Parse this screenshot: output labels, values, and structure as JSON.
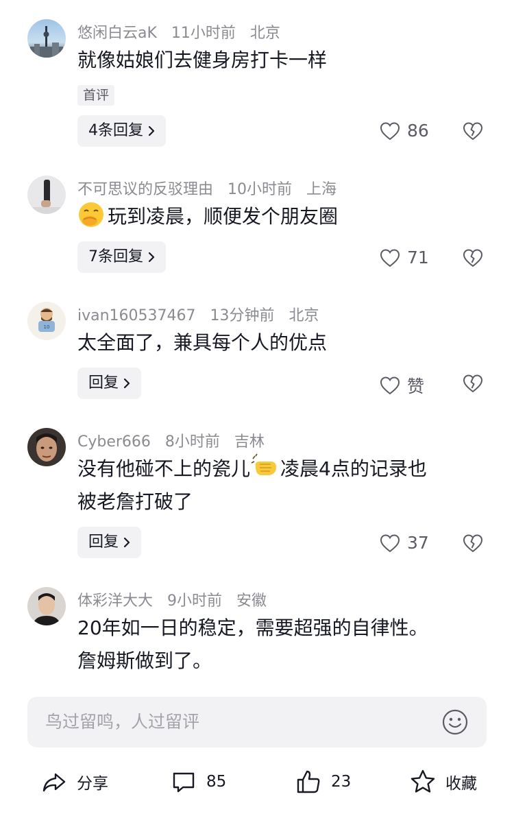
{
  "comments": [
    {
      "username": "悠闲白云aK",
      "time": "11小时前",
      "location": "北京",
      "text": "就像姑娘们去健身房打卡一样",
      "tag": "首评",
      "replies": "4条回复",
      "likes": "86"
    },
    {
      "username": "不可思议的反驳理由",
      "time": "10小时前",
      "location": "上海",
      "emoji": "covering-mouth-emoji",
      "text": "玩到凌晨，顺便发个朋友圈",
      "replies": "7条回复",
      "likes": "71"
    },
    {
      "username": "ivan160537467",
      "time": "13分钟前",
      "location": "北京",
      "text": "太全面了，兼具每个人的优点",
      "replies": "回复",
      "likes": "赞"
    },
    {
      "username": "Cyber666",
      "time": "8小时前",
      "location": "吉林",
      "text_part1": "没有他碰不上的瓷儿",
      "emoji": "slap-hand-emoji",
      "text_part2": "凌晨4点的记录也",
      "text_line2": "被老詹打破了",
      "replies": "回复",
      "likes": "37"
    },
    {
      "username": "体彩洋大大",
      "time": "9小时前",
      "location": "安徽",
      "text_line1": "20年如一日的稳定，需要超强的自律性。",
      "text_line2": "詹姆斯做到了。"
    }
  ],
  "input": {
    "placeholder": "鸟过留鸣，人过留评"
  },
  "bottom_bar": {
    "share": "分享",
    "comments": "85",
    "likes": "23",
    "favorite": "收藏"
  },
  "colors": {
    "text": "#161823",
    "meta": "#8a8b91",
    "chip_bg": "#f2f2f4"
  },
  "icons": [
    "heart-icon",
    "broken-heart-icon",
    "chevron-right-icon",
    "smile-icon",
    "share-icon",
    "comment-icon",
    "thumbs-up-icon",
    "star-icon"
  ]
}
